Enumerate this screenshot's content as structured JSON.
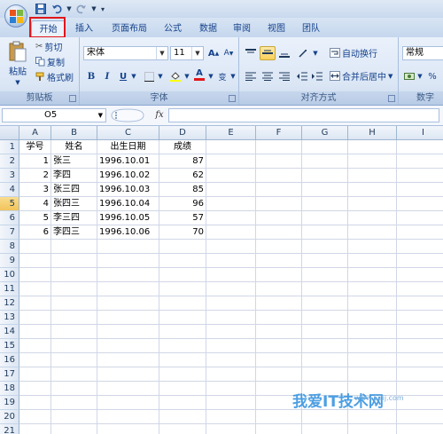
{
  "qat": {
    "save": "save-icon",
    "undo": "undo-icon",
    "redo": "redo-icon"
  },
  "tabs": [
    {
      "label": "开始",
      "active": true
    },
    {
      "label": "插入"
    },
    {
      "label": "页面布局"
    },
    {
      "label": "公式"
    },
    {
      "label": "数据"
    },
    {
      "label": "审阅"
    },
    {
      "label": "视图"
    },
    {
      "label": "团队"
    }
  ],
  "ribbon": {
    "clipboard": {
      "paste": "粘贴",
      "cut": "剪切",
      "copy": "复制",
      "format_painter": "格式刷",
      "label": "剪贴板"
    },
    "font": {
      "name": "宋体",
      "size": "11",
      "label": "字体",
      "bold": "B",
      "italic": "I",
      "underline": "U",
      "grow": "A",
      "shrink": "A",
      "font_color": "A",
      "phonetic": "变"
    },
    "alignment": {
      "wrap": "自动换行",
      "merge": "合并后居中",
      "label": "对齐方式"
    },
    "number": {
      "format": "常规",
      "label": "数字",
      "percent": "%"
    }
  },
  "formula_bar": {
    "name_box": "O5",
    "fx": "fx",
    "value": ""
  },
  "columns": [
    "A",
    "B",
    "C",
    "D",
    "E",
    "F",
    "G",
    "H",
    "I"
  ],
  "rows": [
    "1",
    "2",
    "3",
    "4",
    "5",
    "6",
    "7",
    "8",
    "9",
    "10",
    "11",
    "12",
    "13",
    "14",
    "15",
    "16",
    "17",
    "18",
    "19",
    "20",
    "21"
  ],
  "selected_row": "5",
  "sheet": {
    "headers": [
      "学号",
      "姓名",
      "出生日期",
      "成绩"
    ],
    "records": [
      [
        "1",
        "张三",
        "1996.10.01",
        "87"
      ],
      [
        "2",
        "李四",
        "1996.10.02",
        "62"
      ],
      [
        "3",
        "张三四",
        "1996.10.03",
        "85"
      ],
      [
        "4",
        "张四三",
        "1996.10.04",
        "96"
      ],
      [
        "5",
        "李三四",
        "1996.10.05",
        "57"
      ],
      [
        "6",
        "李四三",
        "1996.10.06",
        "70"
      ]
    ]
  },
  "watermark": {
    "text": "我爱IT技术网",
    "url": "www.52ij.com"
  },
  "colors": {
    "accent": "#15428b",
    "highlight_box": "#e0161b",
    "selected_row": "#f2c45a",
    "gridline": "#d0d7e5"
  }
}
